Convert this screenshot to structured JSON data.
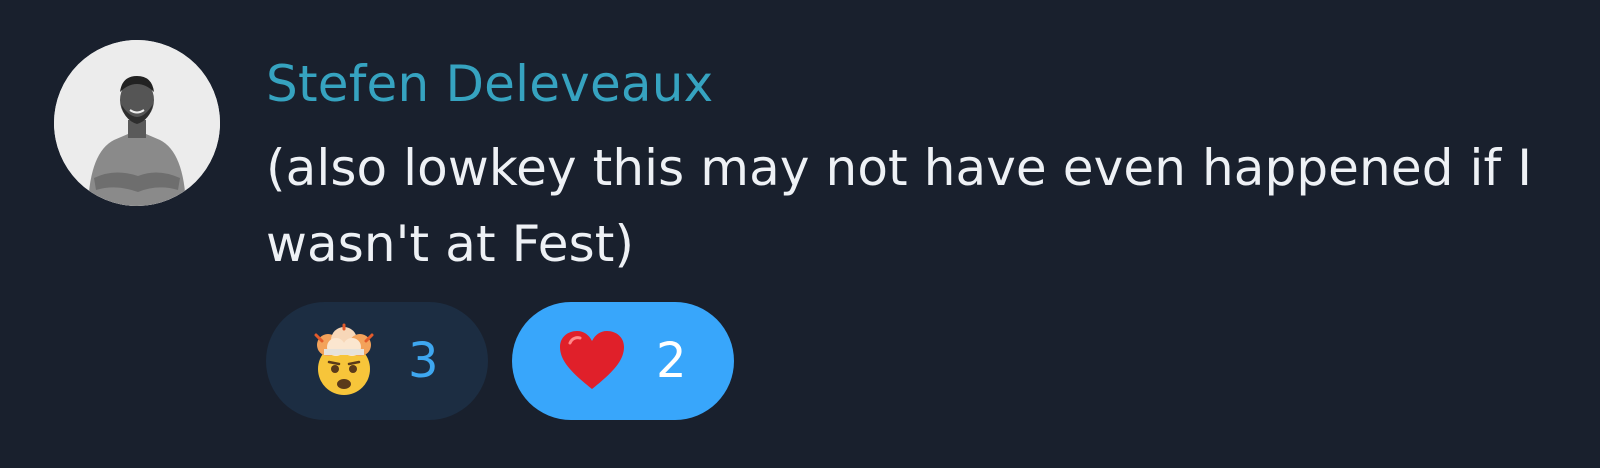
{
  "message": {
    "author": "Stefen Deleveaux",
    "text": "(also lowkey this may not have even happened if I wasn't at Fest)",
    "reactions": [
      {
        "emoji": "exploding-head",
        "count": "3",
        "selected": false
      },
      {
        "emoji": "red-heart",
        "count": "2",
        "selected": true
      }
    ]
  },
  "colors": {
    "background": "#19202d",
    "author": "#36a3c0",
    "text": "#eef1f5",
    "reaction_bg": "#1c2d42",
    "reaction_selected_bg": "#38a6fb",
    "reaction_count": "#3ea7f0"
  }
}
